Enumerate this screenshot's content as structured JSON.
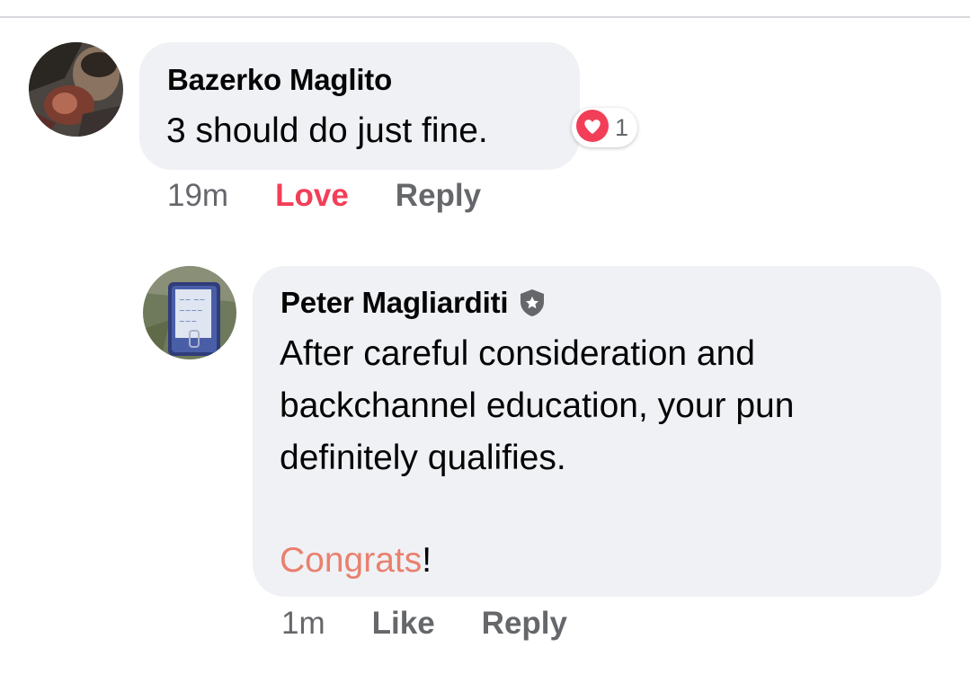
{
  "comments": [
    {
      "author": "Bazerko Maglito",
      "text": "3 should do just fine.",
      "reaction_count": "1",
      "reaction_icon": "heart-reaction-icon",
      "time": "19m",
      "love_label": "Love",
      "reply_label": "Reply"
    },
    {
      "author": "Peter Magliarditi",
      "badge_icon": "shield-star-icon",
      "lines": [
        "After careful consideration and",
        "backchannel education, your pun",
        "definitely qualifies."
      ],
      "highlight": "Congrats",
      "highlight_suffix": "!",
      "time": "1m",
      "like_label": "Like",
      "reply_label": "Reply"
    }
  ],
  "colors": {
    "love_red": "#f33e58",
    "congrats_orange": "#e9806e",
    "action_gray": "#65676b",
    "bubble_bg": "#f0f1f5"
  }
}
